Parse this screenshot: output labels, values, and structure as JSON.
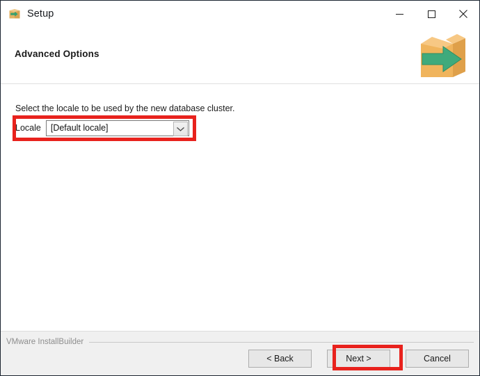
{
  "window": {
    "title": "Setup",
    "icon": "installer-box-icon",
    "controls": [
      {
        "name": "minimize",
        "glyph": "—"
      },
      {
        "name": "maximize",
        "glyph": "□"
      },
      {
        "name": "close",
        "glyph": "✕"
      }
    ]
  },
  "header": {
    "page_title": "Advanced Options",
    "art_icon": "package-box-arrow-icon"
  },
  "content": {
    "instruction": "Select the locale to be used by the new database cluster.",
    "locale": {
      "label": "Locale",
      "value": "[Default locale]",
      "dropdown_icon": "chevron-down-icon"
    }
  },
  "footer": {
    "brand": "VMware InstallBuilder",
    "buttons": {
      "back": "< Back",
      "next": "Next >",
      "cancel": "Cancel"
    }
  },
  "annotations": {
    "highlight_color": "#e8221d",
    "targets": [
      "locale-field",
      "next-button"
    ]
  }
}
